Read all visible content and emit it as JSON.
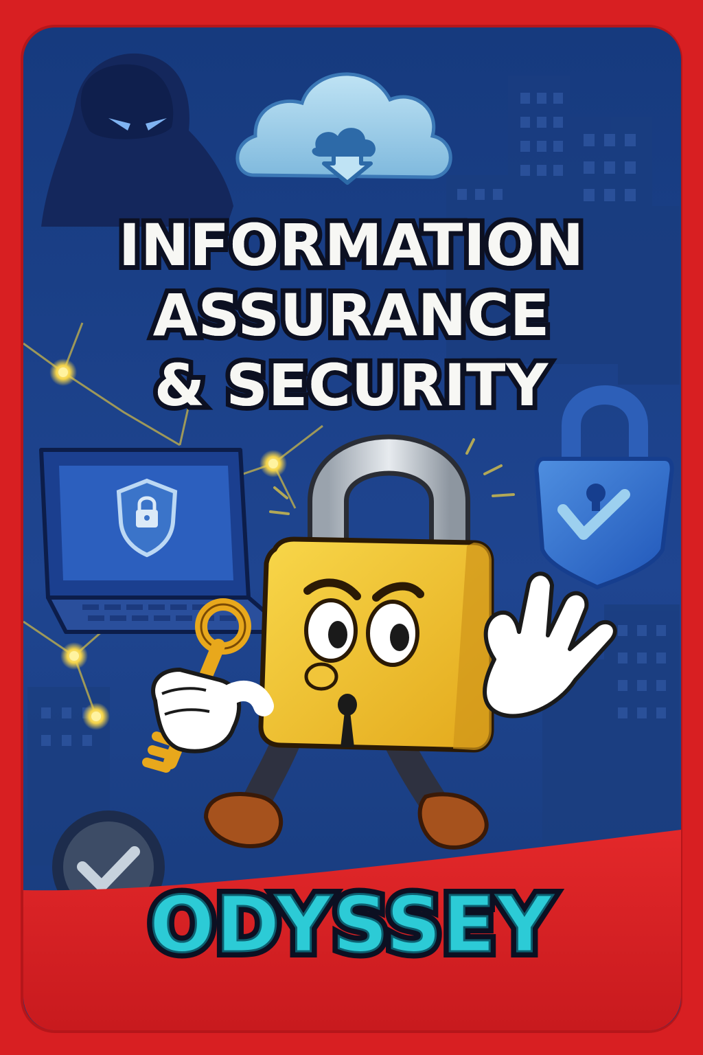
{
  "poster": {
    "title_lines": [
      "INFORMATION",
      "ASSURANCE",
      "& SECURITY"
    ],
    "brand": "ODYSSEY"
  },
  "colors": {
    "frame": "#d81f22",
    "panel_blue": "#1d3f86",
    "title_fill": "#f7f7f4",
    "title_outline": "#0c1022",
    "brand_fill": "#2ccbd6",
    "mascot_yellow": "#f2c12e",
    "glow": "#f5d44a"
  },
  "icons": [
    "hooded-hacker-icon",
    "cloud-download-icon",
    "laptop-shield-icon",
    "blue-padlock-check-icon",
    "check-badge-icon",
    "padlock-mascot-icon",
    "golden-key-icon"
  ]
}
